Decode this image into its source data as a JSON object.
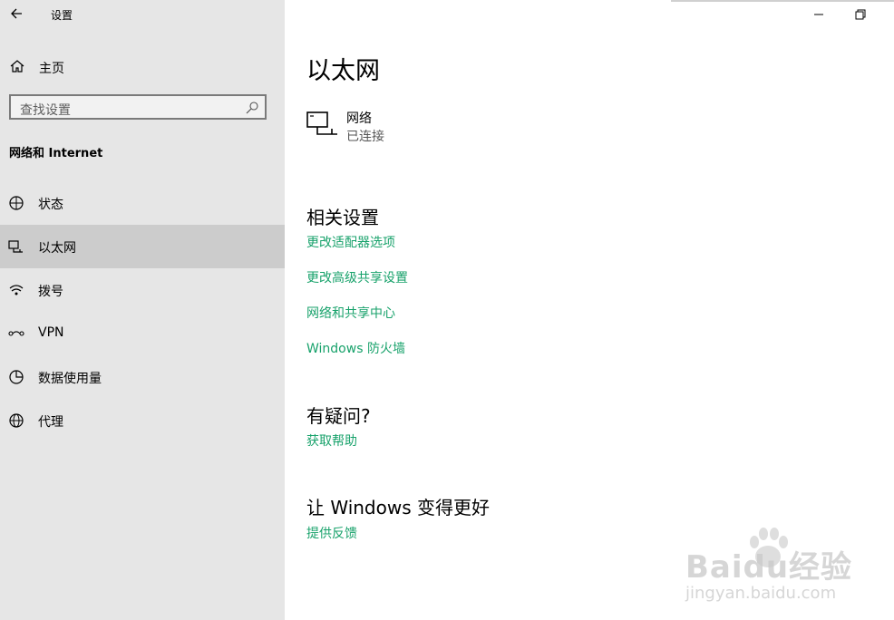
{
  "window": {
    "title": "设置",
    "back_icon": "back-arrow-icon",
    "minimize_icon": "minimize-icon",
    "restore_icon": "restore-icon"
  },
  "sidebar": {
    "home_label": "主页",
    "search_placeholder": "查找设置",
    "section_title": "网络和 Internet",
    "items": [
      {
        "label": "状态",
        "icon": "status-globe-icon"
      },
      {
        "label": "以太网",
        "icon": "ethernet-icon",
        "selected": true
      },
      {
        "label": "拨号",
        "icon": "dialup-icon"
      },
      {
        "label": "VPN",
        "icon": "vpn-icon"
      },
      {
        "label": "数据使用量",
        "icon": "data-usage-icon"
      },
      {
        "label": "代理",
        "icon": "proxy-globe-icon"
      }
    ]
  },
  "main": {
    "title": "以太网",
    "network": {
      "name": "网络",
      "status": "已连接"
    },
    "related": {
      "heading": "相关设置",
      "links": [
        "更改适配器选项",
        "更改高级共享设置",
        "网络和共享中心",
        "Windows 防火墙"
      ]
    },
    "question": {
      "heading": "有疑问?",
      "link": "获取帮助"
    },
    "feedback": {
      "heading": "让 Windows 变得更好",
      "link": "提供反馈"
    }
  },
  "watermark": {
    "logo": "Baidu经验",
    "url": "jingyan.baidu.com"
  },
  "colors": {
    "link": "#18a26b",
    "sidebar_bg": "#e6e6e6",
    "selected_bg": "#cccccc"
  }
}
